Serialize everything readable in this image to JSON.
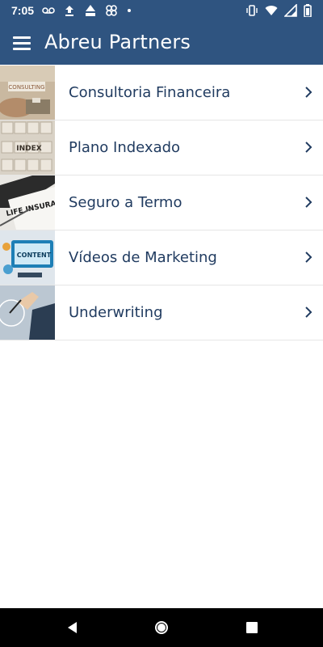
{
  "status_bar": {
    "time": "7:05",
    "left_icons": [
      "voicemail-icon",
      "upload-icon",
      "mm-icon",
      "pinwheel-icon",
      "dot-icon"
    ],
    "right_icons": [
      "vibrate-icon",
      "wifi-icon",
      "signal-icon",
      "battery-icon"
    ]
  },
  "app_bar": {
    "title": "Abreu Partners",
    "color": "#2f5480"
  },
  "list": {
    "items": [
      {
        "label": "Consultoria Financeira",
        "thumb_text": "CONSULTING"
      },
      {
        "label": "Plano Indexado",
        "thumb_text": "INDEX"
      },
      {
        "label": "Seguro a Termo",
        "thumb_text": "LIFE INSURANC"
      },
      {
        "label": "Vídeos de Marketing",
        "thumb_text": "CONTENT"
      },
      {
        "label": "Underwriting",
        "thumb_text": ""
      }
    ],
    "text_color": "#1f3a5f"
  }
}
